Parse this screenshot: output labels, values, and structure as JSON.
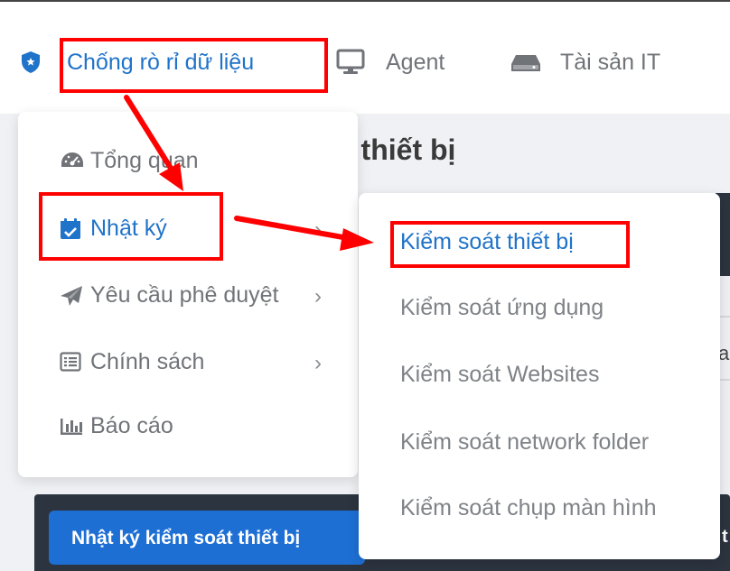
{
  "topnav": {
    "items": [
      {
        "label": "Chống rò rỉ dữ liệu",
        "icon": "shield-icon"
      },
      {
        "label": "Agent",
        "icon": "monitor-icon"
      },
      {
        "label": "Tài sản IT",
        "icon": "hard-drive-icon"
      }
    ]
  },
  "page": {
    "title_fragment": "t thiết bị",
    "cut_text": "a",
    "bottom_button": "Nhật ký kiểm soát thiết bị",
    "bottom_right_fragment": "t"
  },
  "menu": {
    "items": [
      {
        "label": "Tổng quan",
        "icon": "dashboard-gauge-icon"
      },
      {
        "label": "Nhật ký",
        "icon": "calendar-check-icon",
        "has_submenu": true,
        "active": true
      },
      {
        "label": "Yêu cầu phê duyệt",
        "icon": "paper-plane-icon",
        "has_submenu": true
      },
      {
        "label": "Chính sách",
        "icon": "list-icon",
        "has_submenu": true
      },
      {
        "label": "Báo cáo",
        "icon": "bar-chart-icon"
      }
    ],
    "chevron": "›"
  },
  "submenu": {
    "items": [
      {
        "label": "Kiểm soát thiết bị",
        "active": true
      },
      {
        "label": "Kiểm soát ứng dụng"
      },
      {
        "label": "Kiểm soát Websites"
      },
      {
        "label": "Kiểm soát network folder"
      },
      {
        "label": "Kiểm soát chụp màn hình"
      }
    ]
  },
  "colors": {
    "accent": "#1f73c9",
    "annotation": "#ff0000",
    "dark_panel": "#2c3440",
    "button_blue": "#1e6fd4"
  }
}
